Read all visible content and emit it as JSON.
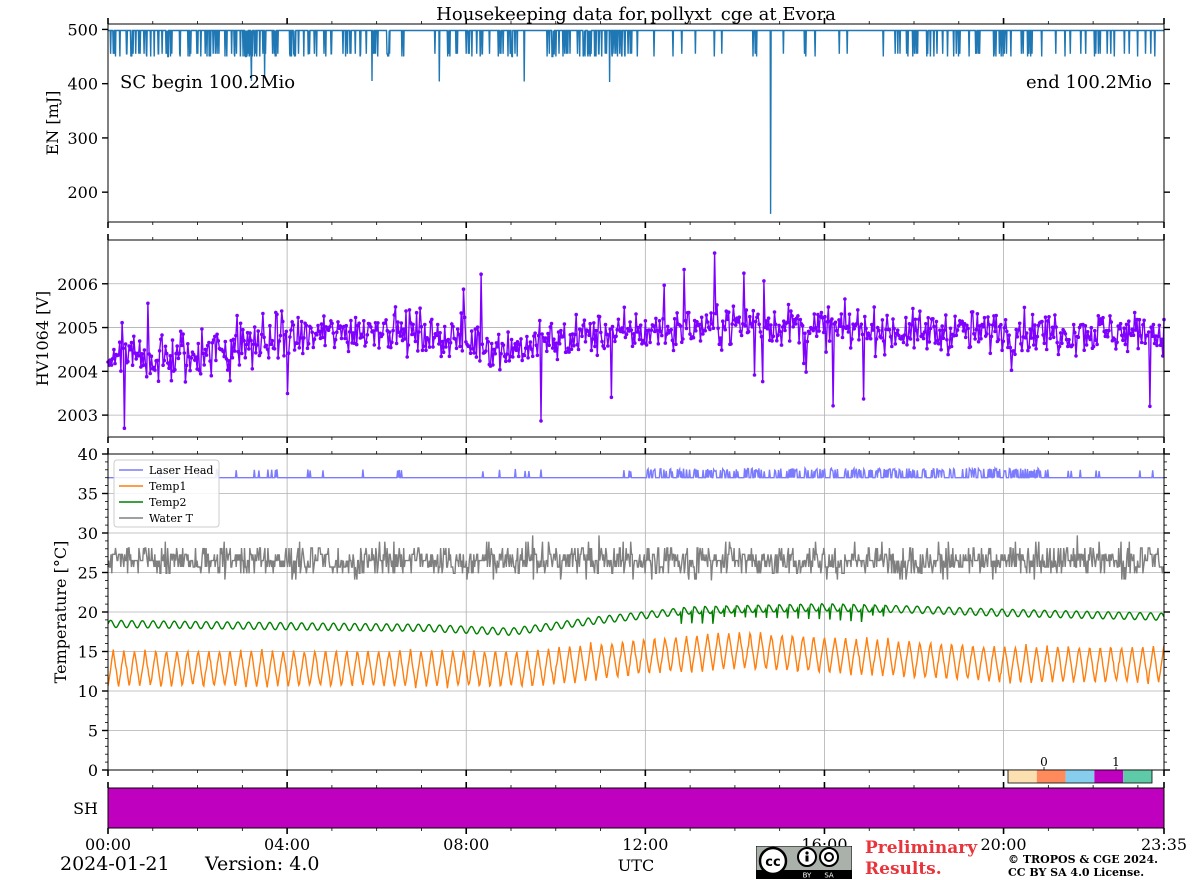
{
  "figure": {
    "title": "Housekeeping data for pollyxt_cge at Evora",
    "date": "2024-01-21",
    "version": "Version: 4.0",
    "xlabel": "UTC",
    "preliminary_line1": "Preliminary",
    "preliminary_line2": "Results.",
    "copyright_line1": "© TROPOS & CGE 2024.",
    "copyright_line2": "CC BY SA 4.0 License.",
    "license_badge": {
      "text_by": "BY",
      "text_sa": "SA",
      "icon": "cc-by-sa-icon"
    }
  },
  "chart_data": [
    {
      "type": "line",
      "panel": "energy",
      "ylabel": "EN [mJ]",
      "ylim": [
        145,
        510
      ],
      "yticks": [
        200,
        300,
        400,
        500
      ],
      "x_range_hours": [
        0,
        23.583
      ],
      "annotation_left": "SC begin 100.2Mio",
      "annotation_right": "end 100.2Mio",
      "series": [
        {
          "color": "#1f77b4",
          "baseline": 498,
          "low_values": [
            450,
            455
          ],
          "deep_drops": [
            {
              "x": 3.2,
              "y": 405
            },
            {
              "x": 3.5,
              "y": 415
            },
            {
              "x": 5.9,
              "y": 405
            },
            {
              "x": 7.4,
              "y": 404
            },
            {
              "x": 9.3,
              "y": 404
            },
            {
              "x": 11.2,
              "y": 403
            },
            {
              "x": 14.8,
              "y": 160
            }
          ]
        }
      ]
    },
    {
      "type": "line",
      "panel": "hv1064",
      "ylabel": "HV1064 [V]",
      "ylim": [
        2002.5,
        2007.0
      ],
      "yticks": [
        2003,
        2004,
        2005,
        2006
      ],
      "x_range_hours": [
        0,
        23.583
      ],
      "grid": true,
      "series": [
        {
          "color": "#7f00ff",
          "marker": "dot",
          "trend": [
            {
              "x": 0,
              "y": 2004.3
            },
            {
              "x": 2,
              "y": 2004.3
            },
            {
              "x": 3,
              "y": 2004.6
            },
            {
              "x": 4.5,
              "y": 2004.8
            },
            {
              "x": 6,
              "y": 2005.0
            },
            {
              "x": 7.5,
              "y": 2004.8
            },
            {
              "x": 9,
              "y": 2004.5
            },
            {
              "x": 10.5,
              "y": 2004.8
            },
            {
              "x": 12,
              "y": 2004.9
            },
            {
              "x": 14,
              "y": 2005.1
            },
            {
              "x": 16,
              "y": 2005.0
            },
            {
              "x": 18,
              "y": 2004.9
            },
            {
              "x": 20,
              "y": 2004.9
            },
            {
              "x": 23.583,
              "y": 2004.9
            }
          ]
        }
      ]
    },
    {
      "type": "line",
      "panel": "temperature",
      "ylabel": "Temperature [$^\\circ C$]",
      "ylim": [
        0,
        40
      ],
      "yticks": [
        0,
        5,
        10,
        15,
        20,
        25,
        30,
        35,
        40
      ],
      "x_range_hours": [
        0,
        23.583
      ],
      "xticks": [
        "00:00",
        "04:00",
        "08:00",
        "12:00",
        "16:00",
        "20:00",
        "23:35"
      ],
      "grid": true,
      "legend": "top-left",
      "series": [
        {
          "name": "Laser Head",
          "color": "#7b7bff",
          "baseline": 37.0,
          "spike": 37.8
        },
        {
          "name": "Temp1",
          "color": "#ff7f0e",
          "low": 10.5,
          "high": 15.2,
          "shift": [
            {
              "x": 0,
              "y": 0
            },
            {
              "x": 9.5,
              "y": 0
            },
            {
              "x": 12,
              "y": 1.5
            },
            {
              "x": 14,
              "y": 2.3
            },
            {
              "x": 17,
              "y": 1.5
            },
            {
              "x": 20,
              "y": 0.5
            },
            {
              "x": 23.583,
              "y": 0.5
            }
          ]
        },
        {
          "name": "Temp2",
          "color": "#008000",
          "trend": [
            {
              "x": 0,
              "y": 18.5
            },
            {
              "x": 4,
              "y": 18.2
            },
            {
              "x": 7,
              "y": 18.0
            },
            {
              "x": 9,
              "y": 17.5
            },
            {
              "x": 11,
              "y": 19.0
            },
            {
              "x": 13,
              "y": 20.2
            },
            {
              "x": 16,
              "y": 20.6
            },
            {
              "x": 18,
              "y": 20.3
            },
            {
              "x": 20,
              "y": 19.9
            },
            {
              "x": 23.583,
              "y": 19.4
            }
          ]
        },
        {
          "name": "Water T",
          "color": "#808080",
          "center": 26.5,
          "spread": 1.5
        }
      ]
    },
    {
      "type": "heatmap",
      "panel": "shutter",
      "ylabel": "SH",
      "value": 2,
      "color": "#bf00bf",
      "colorbar": {
        "ticks": [
          "0",
          "1"
        ],
        "colors": [
          "#fde0b0",
          "#ff8a5c",
          "#87cdee",
          "#bf00bf",
          "#5fcaa7"
        ]
      }
    }
  ]
}
